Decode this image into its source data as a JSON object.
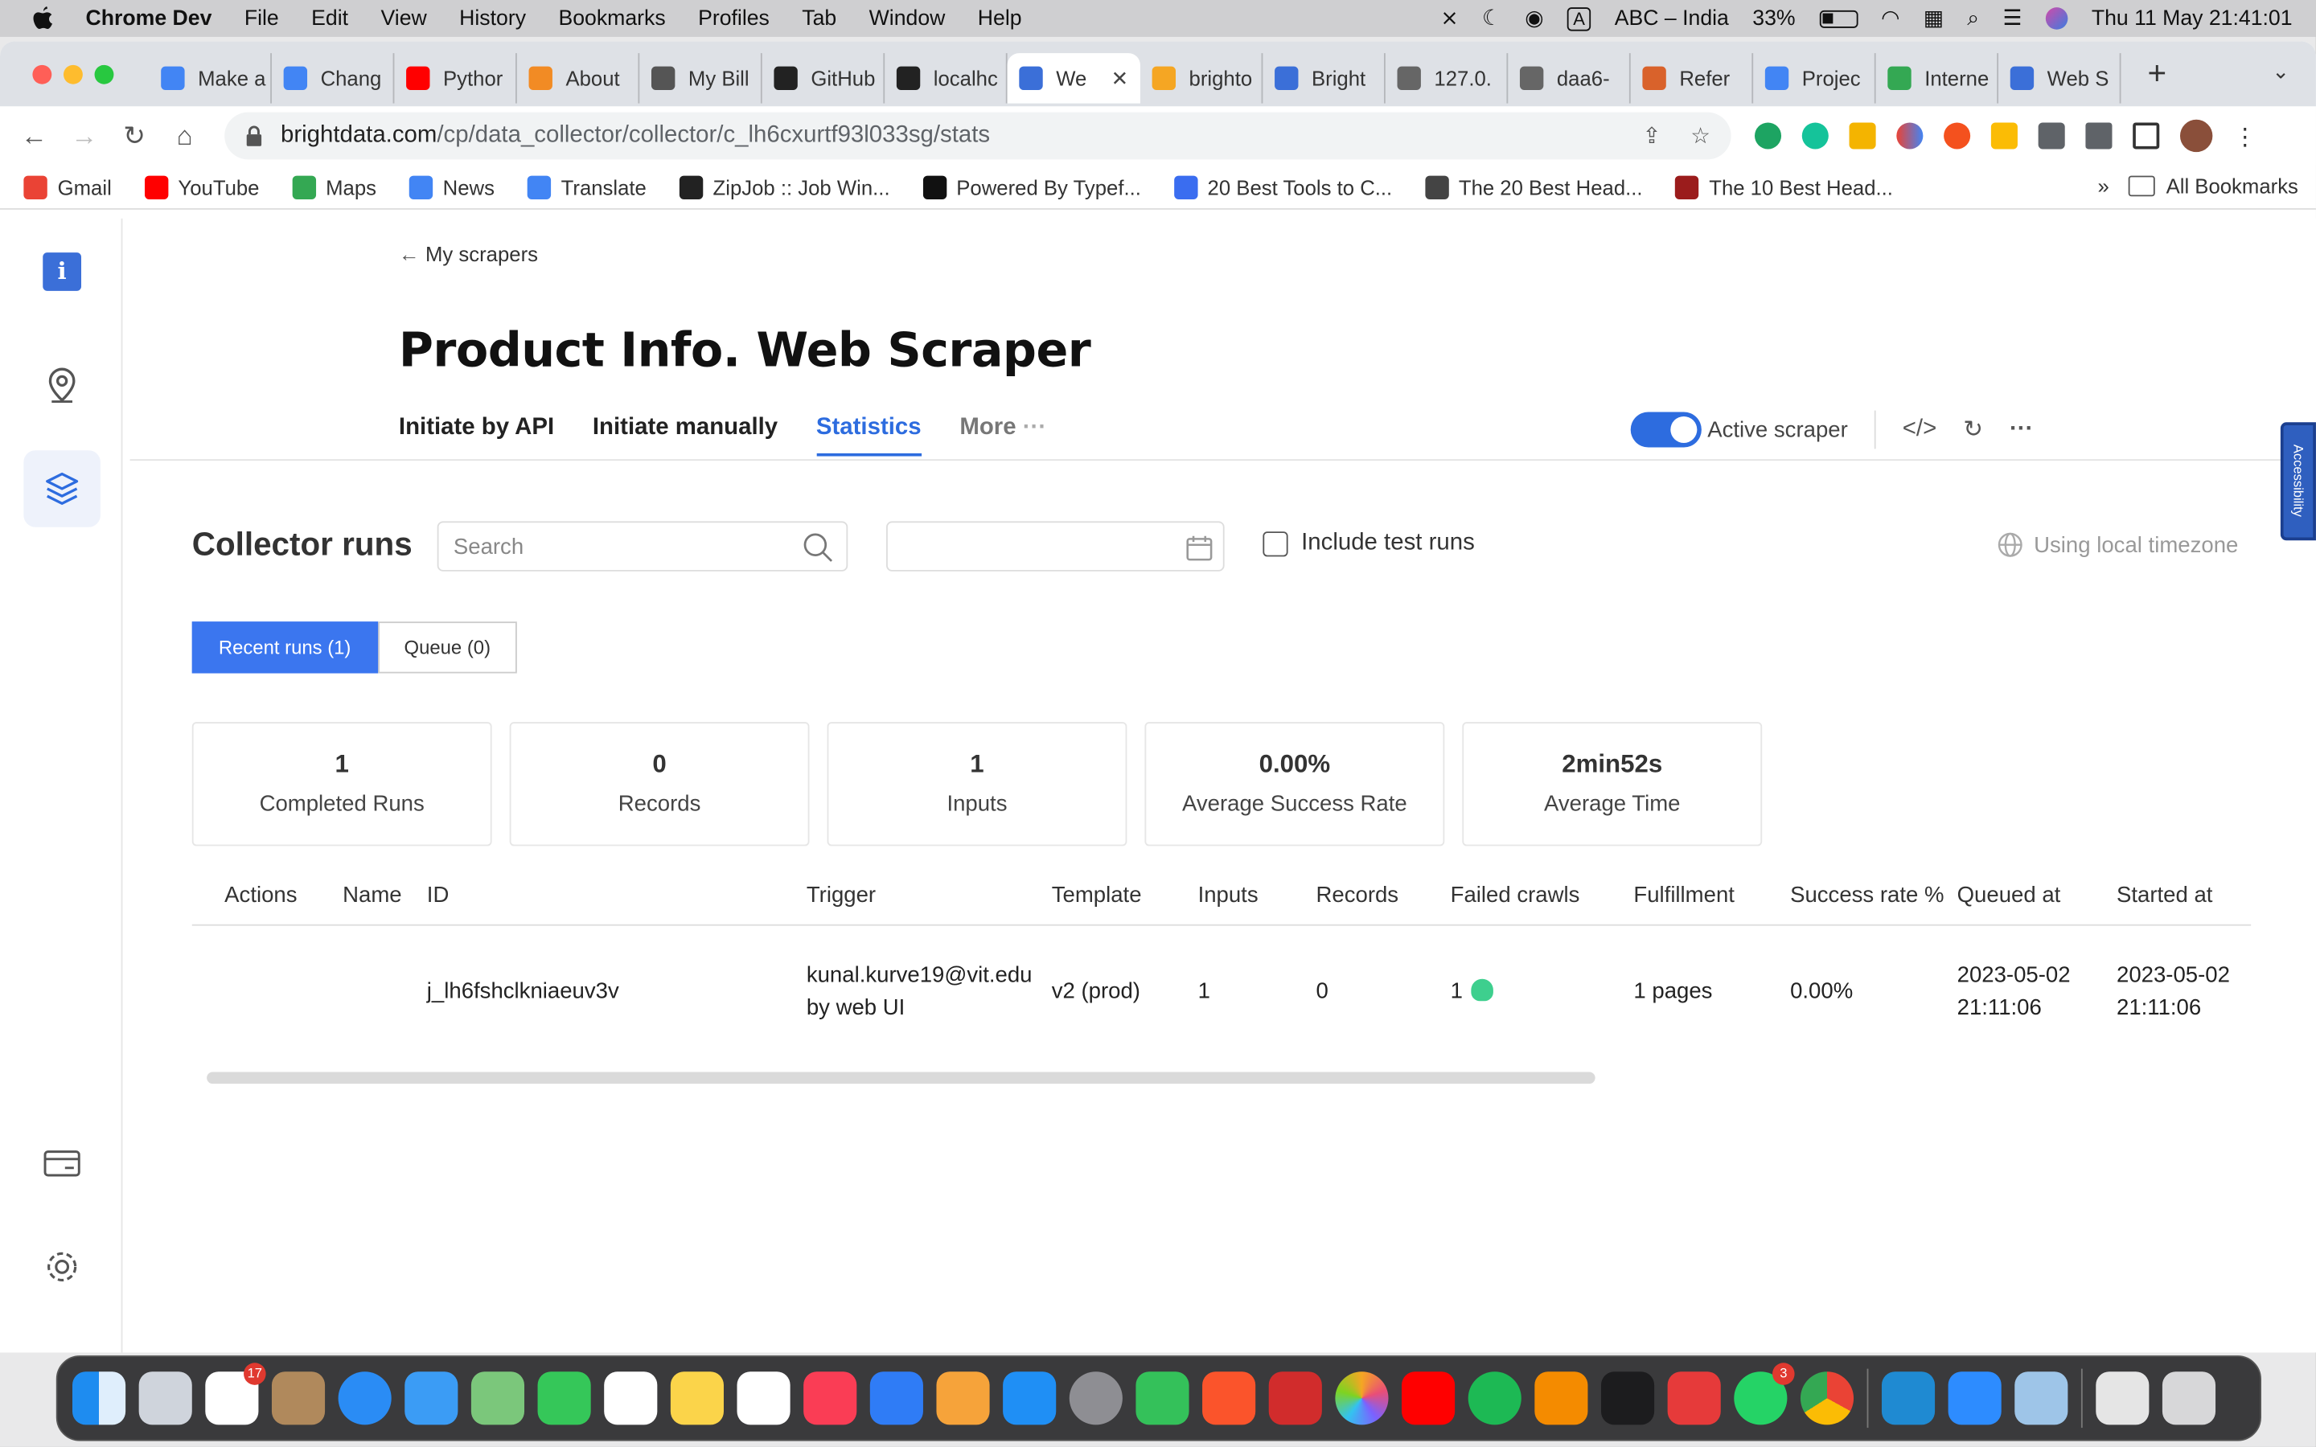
{
  "menubar": {
    "app": "Chrome Dev",
    "items": [
      "File",
      "Edit",
      "View",
      "History",
      "Bookmarks",
      "Profiles",
      "Tab",
      "Window",
      "Help"
    ],
    "input_source": "ABC – India",
    "battery": "33%",
    "datetime": "Thu 11 May  21:41:01"
  },
  "tabs": [
    {
      "label": "Make a",
      "color": "#4285f4"
    },
    {
      "label": "Chang",
      "color": "#4285f4"
    },
    {
      "label": "Pythor",
      "color": "#ff0000"
    },
    {
      "label": "About",
      "color": "#f28b24"
    },
    {
      "label": "My Bill",
      "color": "#555555"
    },
    {
      "label": "GitHub",
      "color": "#222222"
    },
    {
      "label": "localhc",
      "color": "#222222"
    },
    {
      "label": "We",
      "color": "#3b6fd8",
      "active": true
    },
    {
      "label": "brighto",
      "color": "#f5a623"
    },
    {
      "label": "Bright",
      "color": "#3b6fd8"
    },
    {
      "label": "127.0.",
      "color": "#666666"
    },
    {
      "label": "daa6-",
      "color": "#666666"
    },
    {
      "label": "Refer",
      "color": "#d9622b"
    },
    {
      "label": "Projec",
      "color": "#4285f4"
    },
    {
      "label": "Interne",
      "color": "#34a853"
    },
    {
      "label": "Web S",
      "color": "#3b6fd8"
    }
  ],
  "address": {
    "host": "brightdata.com",
    "path": "/cp/data_collector/collector/c_lh6cxurtf93l033sg/stats"
  },
  "bookmarks": [
    {
      "label": "Gmail",
      "color": "#ea4335"
    },
    {
      "label": "YouTube",
      "color": "#ff0000"
    },
    {
      "label": "Maps",
      "color": "#34a853"
    },
    {
      "label": "News",
      "color": "#4285f4"
    },
    {
      "label": "Translate",
      "color": "#4285f4"
    },
    {
      "label": "ZipJob :: Job Win...",
      "color": "#222222"
    },
    {
      "label": "Powered By Typef...",
      "color": "#111111"
    },
    {
      "label": "20 Best Tools to C...",
      "color": "#3a6df0"
    },
    {
      "label": "The 20 Best Head...",
      "color": "#444444"
    },
    {
      "label": "The 10 Best Head...",
      "color": "#9b1c1c"
    }
  ],
  "bookmarks_all": "All Bookmarks",
  "page": {
    "back_label": "My scrapers",
    "title": "Product Info. Web Scraper",
    "tabs": [
      "Initiate by API",
      "Initiate manually",
      "Statistics",
      "More"
    ],
    "active_scraper_label": "Active scraper",
    "accessibility_label": "Accessibility",
    "collector_runs_title": "Collector runs",
    "search_placeholder": "Search",
    "include_test_runs": "Include test runs",
    "timezone": "Using local timezone",
    "segments": [
      "Recent runs (1)",
      "Queue (0)"
    ],
    "cards": [
      {
        "value": "1",
        "label": "Completed Runs"
      },
      {
        "value": "0",
        "label": "Records"
      },
      {
        "value": "1",
        "label": "Inputs"
      },
      {
        "value": "0.00%",
        "label": "Average Success Rate"
      },
      {
        "value": "2min52s",
        "label": "Average Time"
      }
    ],
    "table": {
      "headers": [
        "Actions",
        "Name",
        "ID",
        "Trigger",
        "Template",
        "Inputs",
        "Records",
        "Failed crawls",
        "Fulfillment",
        "Success rate %",
        "Queued at",
        "Started at"
      ],
      "row": {
        "id": "j_lh6fshclkniaeuv3v",
        "trigger_line1": "kunal.kurve19@vit.edu",
        "trigger_line2": "by web UI",
        "template": "v2 (prod)",
        "inputs": "1",
        "records": "0",
        "failed_crawls": "1",
        "fulfillment": "1 pages",
        "success_rate": "0.00%",
        "queued_date": "2023-05-02",
        "queued_time": "21:11:06",
        "started_date": "2023-05-02",
        "started_time": "21:11:06"
      }
    }
  },
  "colors": {
    "accent": "#2d6cdf",
    "segment_active": "#3b76ef",
    "bug": "#3ecf8e"
  }
}
